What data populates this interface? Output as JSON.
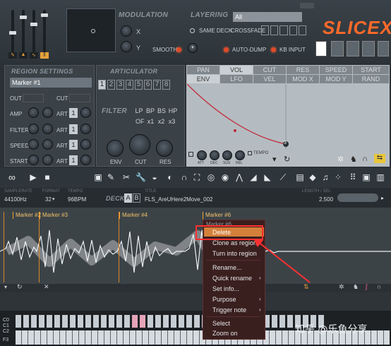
{
  "header": {
    "modulation_title": "MODULATION",
    "axis_x": "X",
    "axis_y": "Y",
    "smooth": "SMOOTH",
    "layering_title": "LAYERING",
    "layer_select": "All",
    "same_deck": "SAME DECK",
    "crossfade": "CROSSFADE",
    "auto_dump": "AUTO-DUMP",
    "kb_input": "KB INPUT",
    "logo": "SLICEX"
  },
  "region_settings": {
    "title": "REGION SETTINGS",
    "marker_select": "Marker #1",
    "rows": [
      "OUT",
      "CUT",
      "AMP",
      "ART",
      "FILTER",
      "ART",
      "SPEED",
      "ART",
      "START",
      "ART"
    ],
    "steps": [
      "1",
      "1",
      "1",
      "1"
    ]
  },
  "articulator": {
    "title": "ARTICULATOR",
    "numbers": [
      "1",
      "2",
      "3",
      "4",
      "5",
      "6",
      "7",
      "8"
    ],
    "filter_label": "FILTER",
    "filter_types": [
      "LP",
      "BP",
      "BS",
      "HP"
    ],
    "of_label": "OF",
    "multipliers": [
      "x1",
      "x2",
      "x3"
    ],
    "knobs": [
      "ENV",
      "CUT",
      "RES"
    ]
  },
  "envelope": {
    "tabs_row1": [
      "PAN",
      "VOL",
      "CUT",
      "RES",
      "SPEED",
      "START"
    ],
    "tabs_row2": [
      "ENV",
      "LFO",
      "VEL",
      "MOD X",
      "MOD Y",
      "RAND"
    ],
    "knobs": [
      "ATT",
      "DEC",
      "SUS",
      "REL"
    ],
    "tempo": "TEMPO",
    "point": "3"
  },
  "info": {
    "samplerate_label": "SAMPLERATE",
    "samplerate": "44100Hz",
    "format_label": "FORMAT",
    "format": "32",
    "tempo_label": "TEMPO",
    "tempo": "96BPM",
    "deck_label": "DECK",
    "deck_a": "A",
    "deck_b": "B",
    "title_label": "TITLE",
    "title": "FLS_AreUHere2Move_002",
    "length_label": "LENGTH / SEL",
    "length": "2.500"
  },
  "markers": [
    "Marker #2",
    "Marker #3",
    "Marker #4",
    "Marker #6"
  ],
  "context_menu": {
    "header": "Marker #6",
    "items": [
      "Delete",
      "Clone as region",
      "Turn into region",
      "Rename...",
      "Quick rename",
      "Set info...",
      "Purpose",
      "Trigger note",
      "Select",
      "Zoom on"
    ]
  },
  "piano": {
    "octaves": [
      "C0",
      "C1",
      "C2",
      "F3"
    ]
  },
  "watermark": "知乎 @乐鱼分享"
}
